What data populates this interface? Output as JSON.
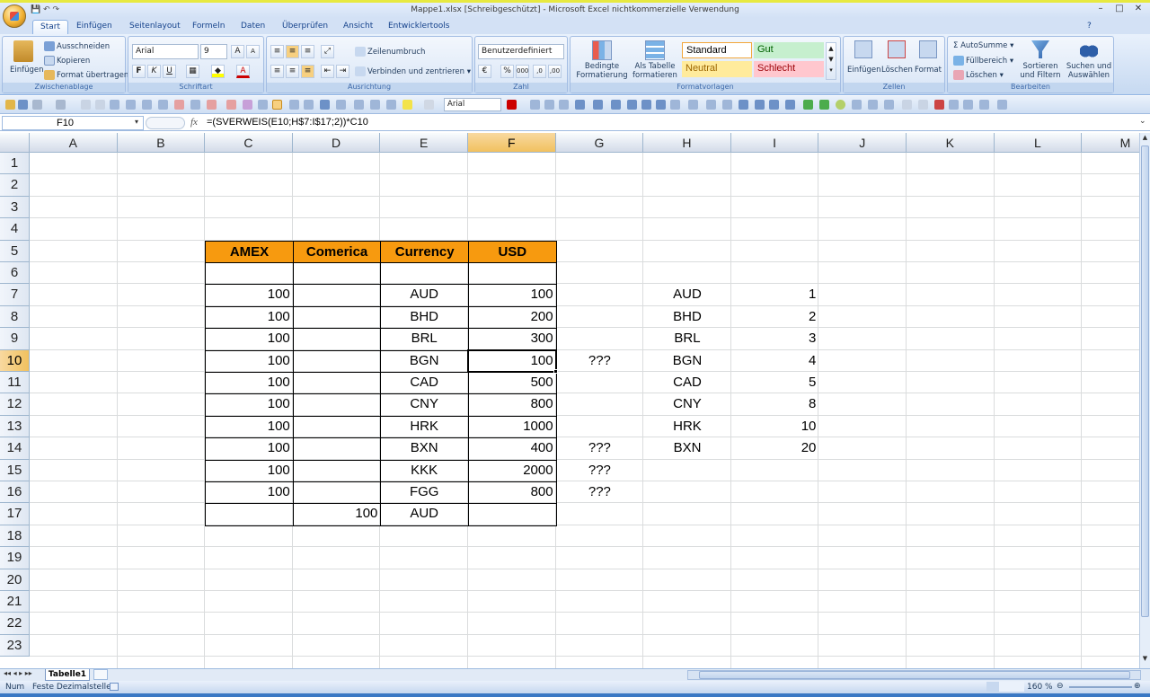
{
  "window": {
    "title": "Mappe1.xlsx  [Schreibgeschützt] - Microsoft Excel nichtkommerzielle Verwendung",
    "controls": [
      "–",
      "□",
      "✕"
    ]
  },
  "ribbon": {
    "tabs": [
      "Start",
      "Einfügen",
      "Seitenlayout",
      "Formeln",
      "Daten",
      "Überprüfen",
      "Ansicht",
      "Entwicklertools"
    ],
    "active_tab": "Start",
    "clipboard": {
      "paste": "Einfügen",
      "cut": "Ausschneiden",
      "copy": "Kopieren",
      "format_painter": "Format übertragen",
      "group": "Zwischenablage"
    },
    "font": {
      "name": "Arial",
      "size": "9",
      "group": "Schriftart"
    },
    "alignment": {
      "wrap": "Zeilenumbruch",
      "merge": "Verbinden und zentrieren",
      "group": "Ausrichtung"
    },
    "number": {
      "format": "Benutzerdefiniert",
      "group": "Zahl"
    },
    "styles": {
      "conditional": "Bedingte Formatierung",
      "as_table": "Als Tabelle formatieren",
      "standard": "Standard",
      "gut": "Gut",
      "neutral": "Neutral",
      "schlecht": "Schlecht",
      "group": "Formatvorlagen"
    },
    "cells": {
      "insert": "Einfügen",
      "delete": "Löschen",
      "format": "Format",
      "group": "Zellen"
    },
    "editing": {
      "autosum": "AutoSumme",
      "fill": "Füllbereich",
      "clear": "Löschen",
      "sort": "Sortieren und Filtern",
      "find": "Suchen und Auswählen",
      "group": "Bearbeiten"
    }
  },
  "toolbar2": {
    "font": "Arial"
  },
  "formula_bar": {
    "name_box": "F10",
    "fx": "fx",
    "formula": "=(SVERWEIS(E10;H$7:I$17;2))*C10"
  },
  "columns": [
    "A",
    "B",
    "C",
    "D",
    "E",
    "F",
    "G",
    "H",
    "I",
    "J",
    "K",
    "L",
    "M"
  ],
  "selected_column": "F",
  "rows": [
    "1",
    "2",
    "3",
    "4",
    "5",
    "6",
    "7",
    "8",
    "9",
    "10",
    "11",
    "12",
    "13",
    "14",
    "15",
    "16",
    "17",
    "18",
    "19",
    "20",
    "21",
    "22",
    "23"
  ],
  "selected_row": "10",
  "table_headers": [
    "AMEX",
    "Comerica",
    "Currency",
    "USD"
  ],
  "table_rows": [
    {
      "row": "7",
      "amex": "100",
      "comerica": "",
      "currency": "AUD",
      "usd": "100",
      "note": ""
    },
    {
      "row": "8",
      "amex": "100",
      "comerica": "",
      "currency": "BHD",
      "usd": "200",
      "note": ""
    },
    {
      "row": "9",
      "amex": "100",
      "comerica": "",
      "currency": "BRL",
      "usd": "300",
      "note": ""
    },
    {
      "row": "10",
      "amex": "100",
      "comerica": "",
      "currency": "BGN",
      "usd": "100",
      "note": "???"
    },
    {
      "row": "11",
      "amex": "100",
      "comerica": "",
      "currency": "CAD",
      "usd": "500",
      "note": ""
    },
    {
      "row": "12",
      "amex": "100",
      "comerica": "",
      "currency": "CNY",
      "usd": "800",
      "note": ""
    },
    {
      "row": "13",
      "amex": "100",
      "comerica": "",
      "currency": "HRK",
      "usd": "1000",
      "note": ""
    },
    {
      "row": "14",
      "amex": "100",
      "comerica": "",
      "currency": "BXN",
      "usd": "400",
      "note": "???"
    },
    {
      "row": "15",
      "amex": "100",
      "comerica": "",
      "currency": "KKK",
      "usd": "2000",
      "note": "???"
    },
    {
      "row": "16",
      "amex": "100",
      "comerica": "",
      "currency": "FGG",
      "usd": "800",
      "note": "???"
    },
    {
      "row": "17",
      "amex": "",
      "comerica": "100",
      "currency": "AUD",
      "usd": "",
      "note": ""
    }
  ],
  "lookup": [
    {
      "code": "AUD",
      "rate": "1"
    },
    {
      "code": "BHD",
      "rate": "2"
    },
    {
      "code": "BRL",
      "rate": "3"
    },
    {
      "code": "BGN",
      "rate": "4"
    },
    {
      "code": "CAD",
      "rate": "5"
    },
    {
      "code": "CNY",
      "rate": "8"
    },
    {
      "code": "HRK",
      "rate": "10"
    },
    {
      "code": "BXN",
      "rate": "20"
    }
  ],
  "sheet_tab": "Tabelle1",
  "status": {
    "mode": "Num",
    "fixed_decimal": "Feste Dezimalstelle",
    "zoom": "160 %"
  },
  "colors": {
    "header_fill": "#f79a0f",
    "selection": "#f1c15f",
    "ribbon_bg": "#d3e1f5",
    "gut_fill": "#c6efce",
    "neutral_fill": "#ffeb9c",
    "schlecht_fill": "#ffc7ce"
  }
}
